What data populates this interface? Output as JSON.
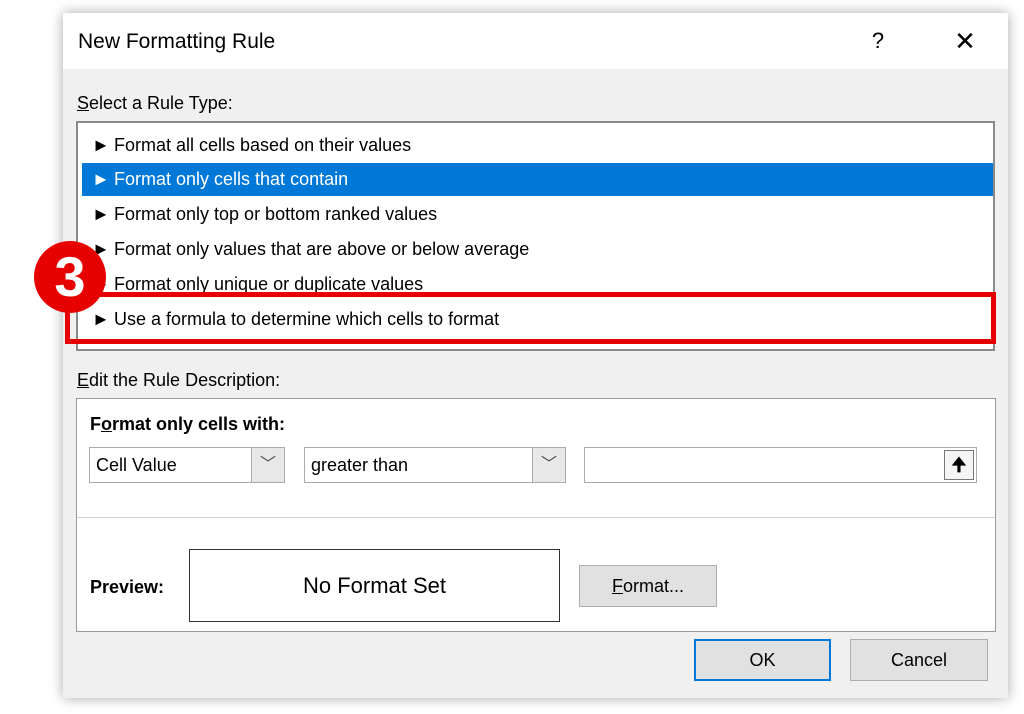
{
  "dialog": {
    "title": "New Formatting Rule",
    "help_glyph": "?",
    "close_glyph": "✕"
  },
  "rule_type": {
    "label_accel": "S",
    "label_rest": "elect a Rule Type:",
    "bullet_glyph": "►",
    "items": [
      {
        "label": "Format all cells based on their values",
        "selected": false
      },
      {
        "label": "Format only cells that contain",
        "selected": true
      },
      {
        "label": "Format only top or bottom ranked values",
        "selected": false
      },
      {
        "label": "Format only values that are above or below average",
        "selected": false
      },
      {
        "label": "Format only unique or duplicate values",
        "selected": false
      },
      {
        "label": "Use a formula to determine which cells to format",
        "selected": false
      }
    ]
  },
  "annotation": {
    "step_number": "3",
    "highlight_color": "#e60000"
  },
  "description": {
    "label_accel": "E",
    "label_rest": "dit the Rule Description:",
    "heading_accel": "o",
    "heading_pre": "F",
    "heading_rest": "rmat only cells with:",
    "combo1_value": "Cell Value",
    "combo2_value": "greater than",
    "value_input": "",
    "dropdown_glyph": "﹀",
    "collapse_glyph": "🠉",
    "preview_label": "Preview:",
    "preview_text": "No Format Set",
    "format_btn_accel": "F",
    "format_btn_rest": "ormat..."
  },
  "footer": {
    "ok_label": "OK",
    "cancel_label": "Cancel"
  },
  "colors": {
    "selection": "#0078d7",
    "dialog_bg": "#f0f0f0"
  }
}
